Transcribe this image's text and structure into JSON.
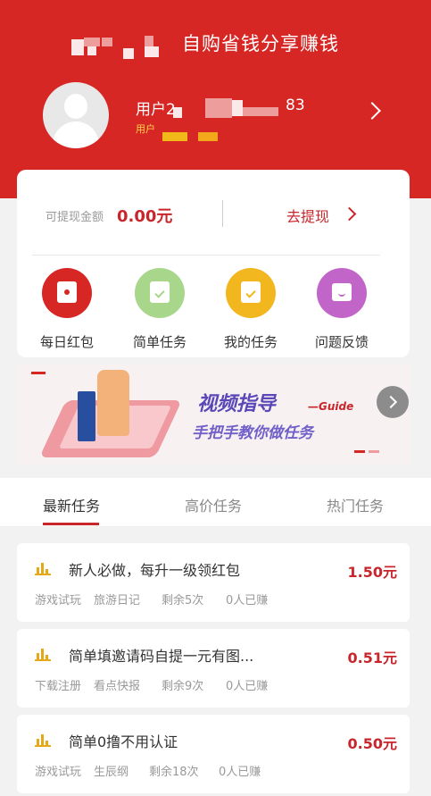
{
  "header": {
    "title": "自购省钱分享赚钱",
    "user_name_prefix": "用户2",
    "user_name_suffix": "83",
    "user_sub_prefix": "用户"
  },
  "wallet": {
    "label": "可提现金额",
    "amount": "0.00元",
    "withdraw_label": "去提现"
  },
  "functions": [
    {
      "label": "每日红包",
      "icon": "red-envelope-icon",
      "color": "#d72725"
    },
    {
      "label": "简单任务",
      "icon": "clipboard-check-icon",
      "color": "#a8d68a"
    },
    {
      "label": "我的任务",
      "icon": "calendar-check-icon",
      "color": "#f2b71f"
    },
    {
      "label": "问题反馈",
      "icon": "chat-smile-icon",
      "color": "#c265c9"
    }
  ],
  "banner": {
    "title": "视频指导",
    "title_en": "—Guide",
    "subtitle": "手把手教你做任务"
  },
  "tabs": [
    {
      "label": "最新任务",
      "active": true
    },
    {
      "label": "高价任务",
      "active": false
    },
    {
      "label": "热门任务",
      "active": false
    }
  ],
  "tasks": [
    {
      "name": "新人必做，每升一级领红包",
      "price": "1.50元",
      "tags": [
        "游戏试玩",
        "旅游日记",
        "剩余5次",
        "0人已赚"
      ]
    },
    {
      "name": "简单填邀请码自提一元有图...",
      "price": "0.51元",
      "tags": [
        "下载注册",
        "看点快报",
        "剩余9次",
        "0人已赚"
      ]
    },
    {
      "name": "简单0撸不用认证",
      "price": "0.50元",
      "tags": [
        "游戏试玩",
        "生辰纲",
        "剩余18次",
        "0人已赚"
      ]
    }
  ],
  "colors": {
    "brand": "#d72725",
    "price": "#c8262b",
    "bar_icon": "#e6a817"
  }
}
